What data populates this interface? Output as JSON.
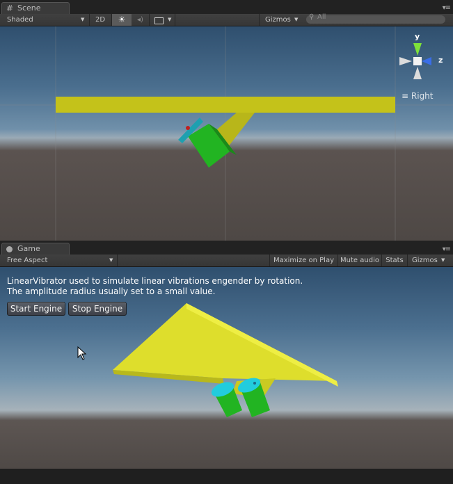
{
  "scene": {
    "tab_label": "Scene",
    "toolbar": {
      "shading_mode": "Shaded",
      "mode_2d": "2D",
      "gizmos_label": "Gizmos",
      "search_placeholder": "All"
    },
    "orientation": {
      "y_label": "y",
      "z_label": "z",
      "view_label": "Right"
    }
  },
  "game": {
    "tab_label": "Game",
    "toolbar": {
      "aspect": "Free Aspect",
      "maximize_label": "Maximize on Play",
      "mute_label": "Mute audio",
      "stats_label": "Stats",
      "gizmos_label": "Gizmos"
    },
    "info_line1": "LinearVibrator used to simulate linear vibrations engender by rotation.",
    "info_line2": "The amplitude radius usually set to a small value.",
    "start_label": "Start Engine",
    "stop_label": "Stop Engine"
  },
  "colors": {
    "accent_yellow": "#c8c820",
    "green_cylinder": "#22bb22",
    "cyan_cap": "#22ccdd",
    "axis_y": "#7ee23a",
    "axis_z": "#3a6ee8"
  }
}
